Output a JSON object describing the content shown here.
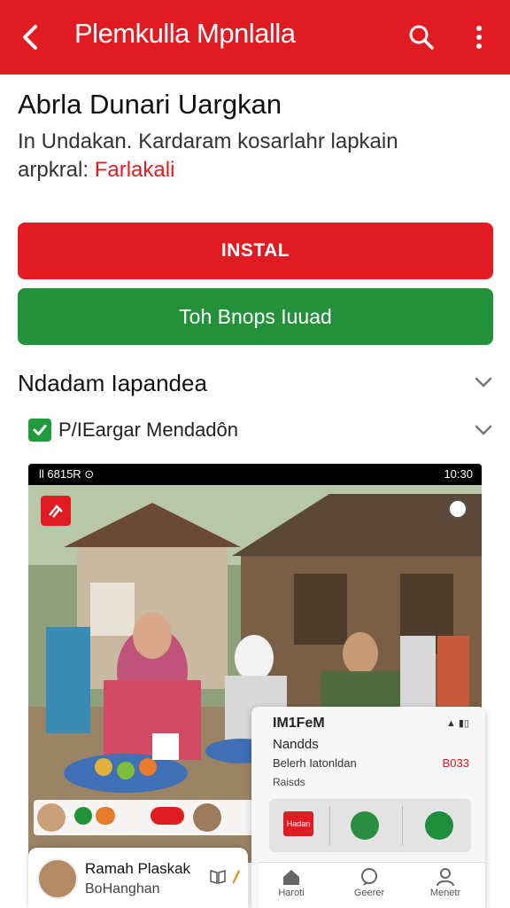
{
  "topbar": {
    "title": "Plemkulla Mpnlalla",
    "back_icon": "back-arrow-icon",
    "search_icon": "search-icon",
    "more_icon": "more-vert-icon"
  },
  "headline": "Abrla Dunari Uargkan",
  "description": {
    "line1": "In Undakan. Kardaram kosarlahr lapkain",
    "line2_prefix": "arpkral:",
    "line2_highlight": "Farlakali"
  },
  "buttons": {
    "install": "INSTAL",
    "secondary": "Toh Bnops Iuuad"
  },
  "sections": {
    "main_label": "Ndadam Iapandea",
    "sub_label": "P/IEargar Mendadôn"
  },
  "screenshot": {
    "status_left": "ll 6815R ⊙",
    "status_right": "10:30"
  },
  "overlay_card": {
    "title": "IM1FeM",
    "name": "Nandds",
    "detail": "Belerh Iatonldan",
    "price": "B033",
    "meta": "Raisds",
    "app_label": "Hadan"
  },
  "bottom_nav": {
    "items": [
      {
        "label": "Haroti",
        "icon": "home-icon"
      },
      {
        "label": "Geerer",
        "icon": "chat-icon"
      },
      {
        "label": "Menetr",
        "icon": "person-icon"
      }
    ]
  },
  "profile_card": {
    "name": "Ramah Plaskak",
    "subtitle": "BoHanghan"
  },
  "colors": {
    "brand_red": "#e11b22",
    "accent_green": "#23913a"
  }
}
